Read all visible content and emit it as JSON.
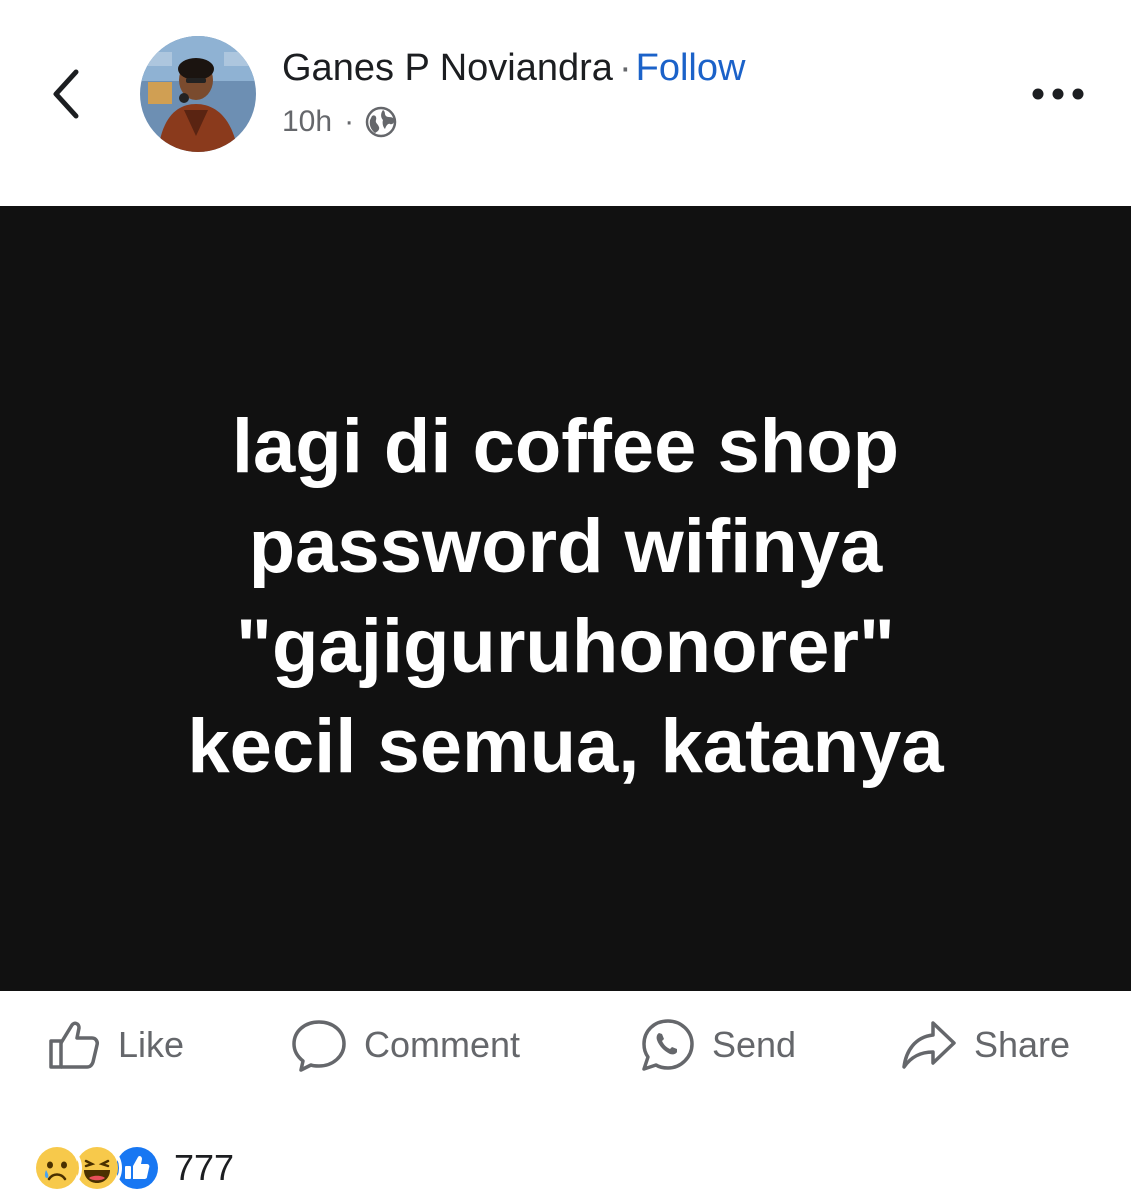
{
  "header": {
    "back_icon": "chevron-left-icon",
    "author_name": "Ganes P Noviandra",
    "separator": "·",
    "follow_label": "Follow",
    "timestamp": "10h",
    "meta_separator": "·",
    "audience_icon": "globe-icon",
    "more_icon": "more-horizontal-icon"
  },
  "post": {
    "background_color": "#111111",
    "text_color": "#ffffff",
    "lines": [
      "lagi di coffee shop",
      "password wifinya",
      "\"gajiguruhonorer\"",
      "kecil semua, katanya"
    ]
  },
  "actions": {
    "like_label": "Like",
    "comment_label": "Comment",
    "send_label": "Send",
    "share_label": "Share"
  },
  "reactions": {
    "icons": [
      "sad-reaction-icon",
      "haha-reaction-icon",
      "like-reaction-icon"
    ],
    "count": "777"
  },
  "colors": {
    "link_blue": "#1b62c9",
    "secondary_text": "#65676b",
    "like_blue": "#1877f2"
  }
}
